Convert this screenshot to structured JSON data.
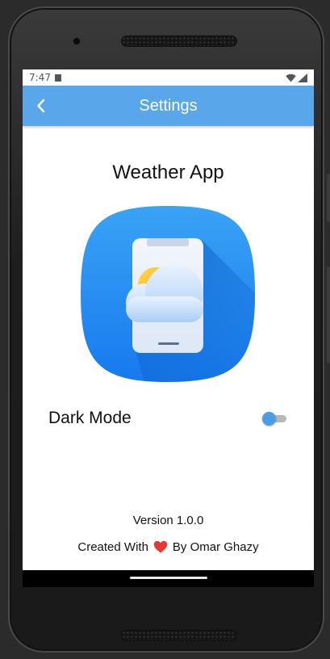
{
  "status_bar": {
    "time": "7:47"
  },
  "app_bar": {
    "title": "Settings"
  },
  "content": {
    "app_name": "Weather App",
    "dark_mode_label": "Dark Mode",
    "dark_mode_enabled": false,
    "version_text": "Version 1.0.0",
    "credits_prefix": "Created With",
    "credits_suffix": "By Omar Ghazy"
  },
  "colors": {
    "app_bar": "#5aa6eb",
    "accent": "#4a9de8",
    "heart": "#e53935",
    "screen_background": "#ffffff"
  },
  "icons": {
    "back": "chevron-left-icon",
    "heart": "heart-icon",
    "logo": "weather-app-logo",
    "wifi": "wifi-icon",
    "signal": "signal-icon",
    "sd_card": "sd-card-icon"
  }
}
